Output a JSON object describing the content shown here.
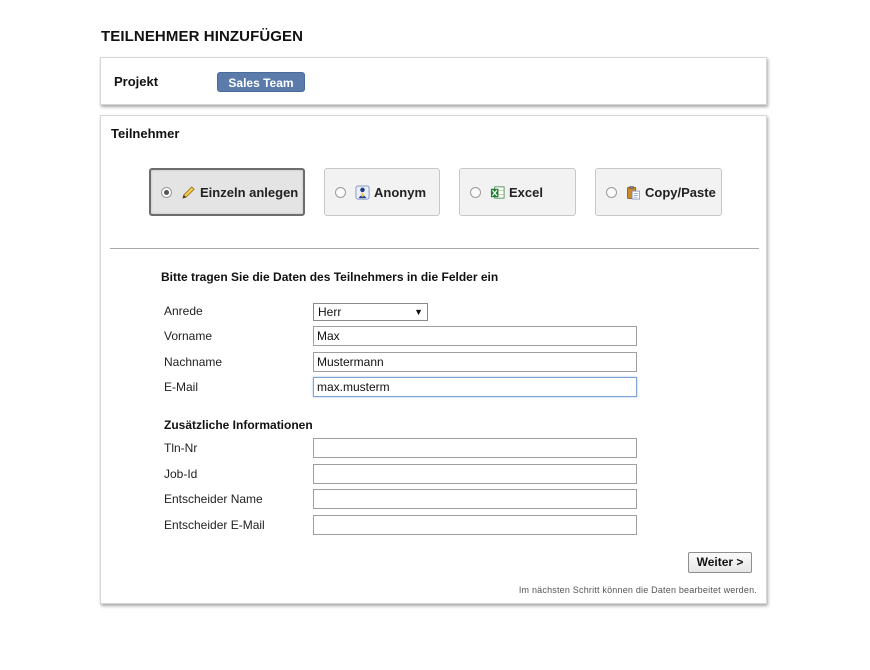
{
  "page": {
    "title": "TEILNEHMER HINZUFÜGEN"
  },
  "project": {
    "label": "Projekt",
    "value": "Sales Team"
  },
  "participants": {
    "title": "Teilnehmer",
    "modes": [
      {
        "label": "Einzeln anlegen",
        "icon": "pencil-icon",
        "selected": true
      },
      {
        "label": "Anonym",
        "icon": "anonymous-user-icon",
        "selected": false
      },
      {
        "label": "Excel",
        "icon": "excel-icon",
        "selected": false
      },
      {
        "label": "Copy/Paste",
        "icon": "clipboard-icon",
        "selected": false
      }
    ]
  },
  "form": {
    "instruction": "Bitte tragen Sie die Daten des Teilnehmers in die Felder ein",
    "fields": {
      "anrede": {
        "label": "Anrede",
        "value": "Herr"
      },
      "vorname": {
        "label": "Vorname",
        "value": "Max"
      },
      "nachname": {
        "label": "Nachname",
        "value": "Mustermann"
      },
      "email": {
        "label": "E-Mail",
        "value": "max.musterm"
      }
    },
    "additional_heading": "Zusätzliche Informationen",
    "additional": {
      "tln_nr": {
        "label": "Tln-Nr",
        "value": ""
      },
      "job_id": {
        "label": "Job-Id",
        "value": ""
      },
      "entscheider_name": {
        "label": "Entscheider Name",
        "value": ""
      },
      "entscheider_email": {
        "label": "Entscheider E-Mail",
        "value": ""
      }
    },
    "next_label": "Weiter >",
    "footnote": "Im nächsten Schritt können die Daten bearbeitet werden."
  },
  "colors": {
    "badge": "#5b7bab",
    "focus_border": "#7fa3d6"
  }
}
